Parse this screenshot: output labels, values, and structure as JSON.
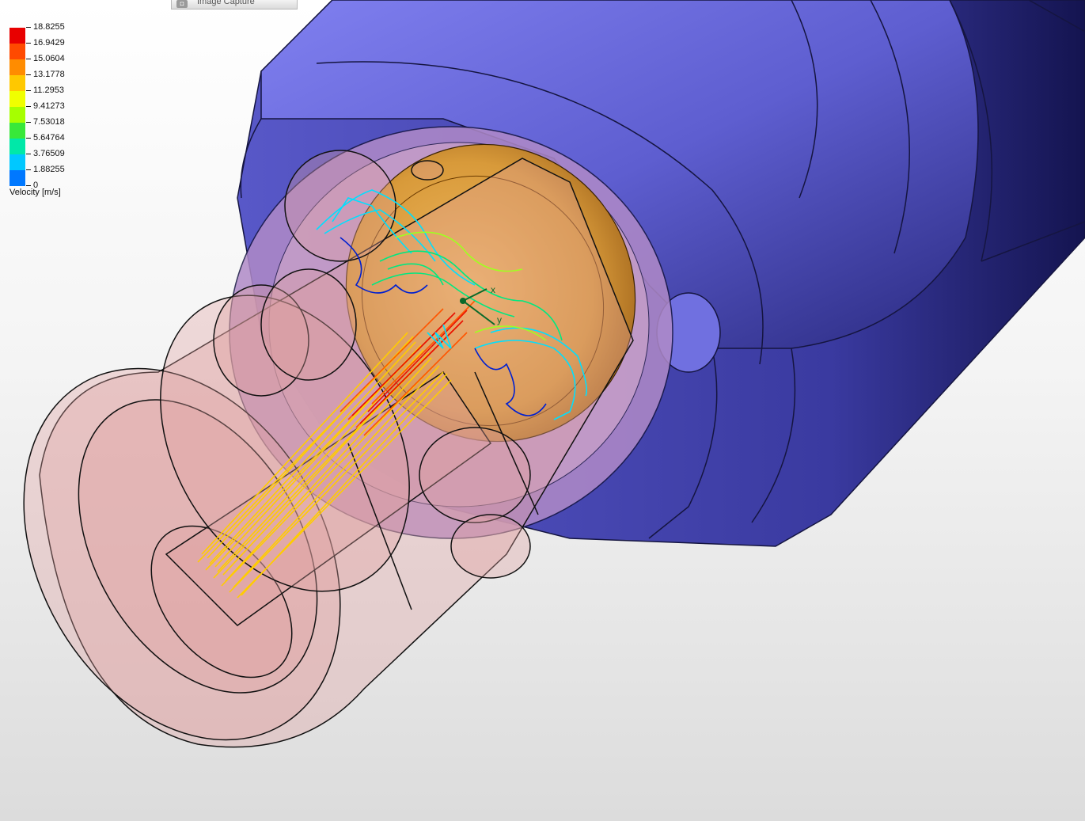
{
  "window": {
    "capture_label": "Image Capture",
    "capture_icon": "camera-icon"
  },
  "legend": {
    "title": "Velocity [m/s]",
    "ticks": [
      "18.8255",
      "16.9429",
      "15.0604",
      "13.1778",
      "11.2953",
      "9.41273",
      "7.53018",
      "5.64764",
      "3.76509",
      "1.88255",
      "0"
    ],
    "colors": [
      "#e80000",
      "#ff4a00",
      "#ff8c00",
      "#ffc800",
      "#f0ff00",
      "#a6ff00",
      "#38e83a",
      "#00e8a8",
      "#00c8ff",
      "#0078ff",
      "#0010f0"
    ]
  },
  "triad": {
    "x_label": "x",
    "y_label": "y"
  },
  "colors": {
    "housing": "#6a6ad8",
    "housing_dark": "#2a2a80",
    "transparent_part": "#e8b0b0",
    "disc": "#d89a3a"
  }
}
